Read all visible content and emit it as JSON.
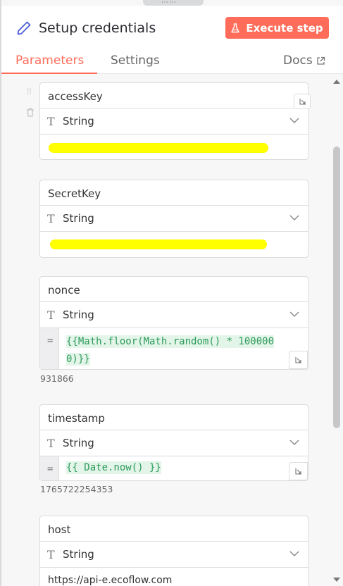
{
  "header": {
    "title": "Setup credentials",
    "title_icon": "pencil-icon",
    "execute_label": "Execute step",
    "execute_icon": "flask-icon"
  },
  "tabs": {
    "parameters": "Parameters",
    "settings": "Settings",
    "docs": "Docs"
  },
  "fields": [
    {
      "name": "accessKey",
      "type": "String",
      "value": ""
    },
    {
      "name": "SecretKey",
      "type": "String",
      "value": ""
    },
    {
      "name": "nonce",
      "type": "String",
      "expression": "{{Math.floor(Math.random() * 100000",
      "expression_cont": "0)}}",
      "hint": "931866"
    },
    {
      "name": "timestamp",
      "type": "String",
      "expression": "{{ Date.now() }}",
      "hint": "1765722254353"
    },
    {
      "name": "host",
      "type": "String",
      "value": "https://api-e.ecoflow.com"
    }
  ],
  "type_icon": "T",
  "colors": {
    "accent": "#ff6d5a",
    "expression_text": "#2d9a5b",
    "expression_bg": "#e2f5e8",
    "redaction": "#ffff00"
  }
}
